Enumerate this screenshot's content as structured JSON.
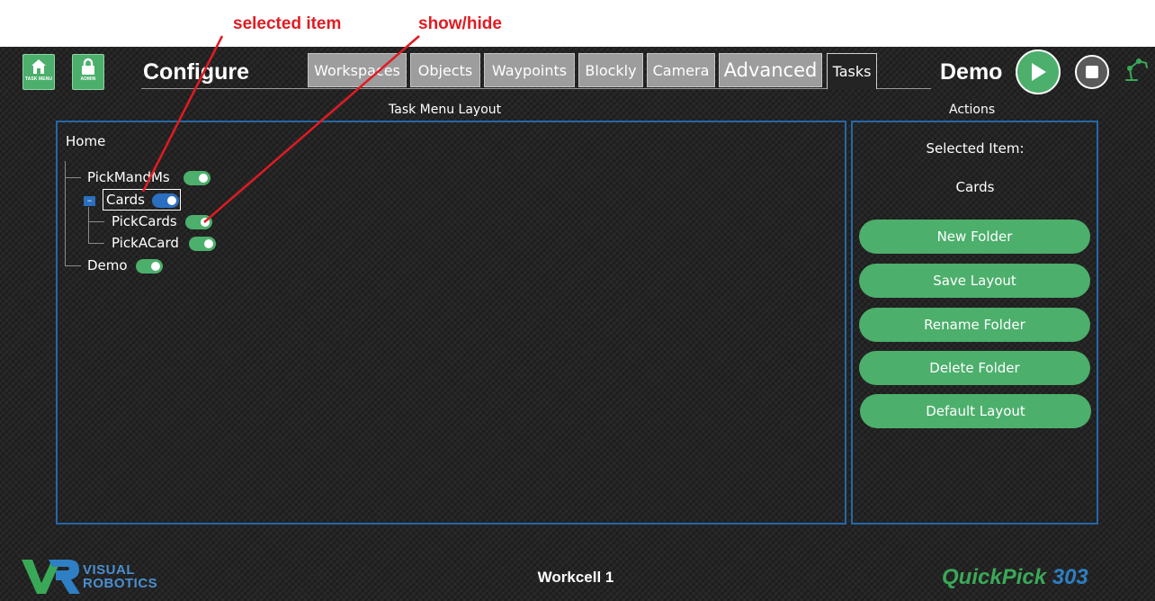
{
  "annotations": {
    "selected_item": "selected item",
    "show_hide": "show/hide"
  },
  "header": {
    "task_menu_caption": "TASK MENU",
    "admin_caption": "ADMIN",
    "title": "Configure",
    "tabs": [
      {
        "label": "Workspaces"
      },
      {
        "label": "Objects"
      },
      {
        "label": "Waypoints"
      },
      {
        "label": "Blockly"
      },
      {
        "label": "Camera"
      },
      {
        "label": "Advanced"
      },
      {
        "label": "Tasks",
        "active": true
      }
    ],
    "workcell_name": "Demo",
    "icons": [
      "home-icon",
      "lock-icon",
      "play-icon",
      "stop-icon",
      "robot-arm-icon"
    ]
  },
  "layout_panel": {
    "title": "Task Menu Layout",
    "tree": {
      "root": "Home",
      "items": [
        {
          "label": "PickMandMs",
          "visible": true
        },
        {
          "label": "Cards",
          "visible": true,
          "selected": true,
          "expanded": true,
          "children": [
            {
              "label": "PickCards",
              "visible": true
            },
            {
              "label": "PickACard",
              "visible": true
            }
          ]
        },
        {
          "label": "Demo",
          "visible": true
        }
      ],
      "collapse_glyph": "–"
    }
  },
  "actions_panel": {
    "title": "Actions",
    "selected_label": "Selected Item:",
    "selected_value": "Cards",
    "buttons": {
      "new_folder": "New Folder",
      "save_layout": "Save Layout",
      "rename_folder": "Rename Folder",
      "delete_folder": "Delete Folder",
      "default_layout": "Default Layout"
    }
  },
  "footer": {
    "logo_line1": "VISUAL",
    "logo_line2": "ROBOTICS",
    "workcell": "Workcell 1",
    "product_part1": "QuickPick",
    "product_part2": "303"
  },
  "colors": {
    "accent_green": "#4caf6c",
    "panel_border": "#2468a8",
    "toggle_selected": "#2a6fc0",
    "annotation_red": "#e11b22",
    "product_green": "#3aa957",
    "product_blue": "#2e7fc4"
  }
}
